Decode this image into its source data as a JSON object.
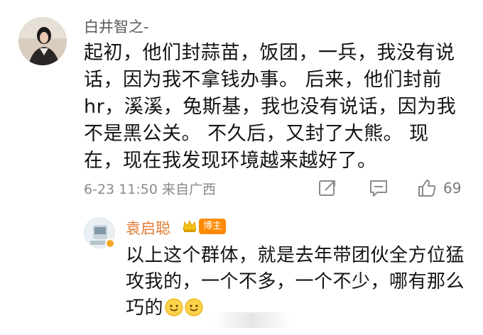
{
  "comment": {
    "username": "白井智之-",
    "text": "起初，他们封蒜苗，饭团，一兵，我没有说话，因为我不拿钱办事。 后来，他们封前hr，溪溪，兔斯基，我也没有说话，因为我不是黑公关。 不久后，又封了大熊。 现在，现在我发现环境越来越好了。",
    "meta": "6-23 11:50  来自广西",
    "like_count": "69",
    "icons": [
      "share-icon",
      "comment-icon",
      "like-icon"
    ]
  },
  "reply": {
    "username": "袁启聪",
    "author_tag": "博主",
    "text": "以上这个群体，就是去年带团伙全方位猛攻我的，一个不多，一个不少，哪有那么巧的",
    "emoji_count": 2,
    "colors": {
      "name": "#e07a2f",
      "tag": "#ff8a00"
    }
  }
}
